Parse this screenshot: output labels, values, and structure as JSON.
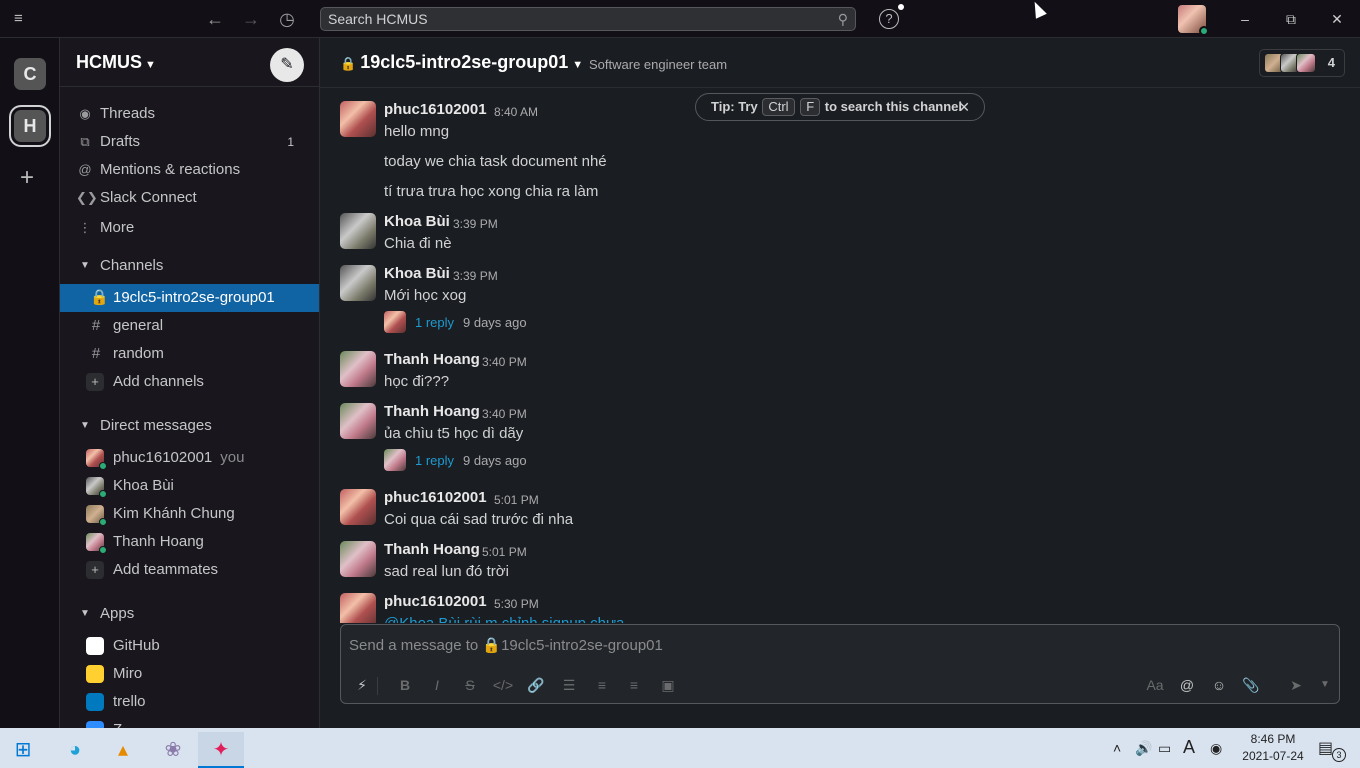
{
  "topbar": {
    "search_placeholder": "Search HCMUS",
    "help_label": "?"
  },
  "workspaces": [
    {
      "letter": "C"
    },
    {
      "letter": "H"
    }
  ],
  "sidebar": {
    "workspace_name": "HCMUS",
    "nav": [
      {
        "label": "Threads",
        "icon": "threads-icon"
      },
      {
        "label": "Drafts",
        "icon": "drafts-icon",
        "count": "1"
      },
      {
        "label": "Mentions & reactions",
        "icon": "at-icon"
      },
      {
        "label": "Slack Connect",
        "icon": "slack-connect-icon"
      },
      {
        "label": "More",
        "icon": "more-vertical-icon"
      }
    ],
    "channels_header": "Channels",
    "channels": [
      {
        "name": "19clc5-intro2se-group01",
        "private": true,
        "selected": true
      },
      {
        "name": "general",
        "private": false
      },
      {
        "name": "random",
        "private": false
      }
    ],
    "add_channels": "Add channels",
    "dm_header": "Direct messages",
    "dms": [
      {
        "name": "phuc16102001",
        "you": "you"
      },
      {
        "name": "Khoa Bùi"
      },
      {
        "name": "Kim Khánh Chung"
      },
      {
        "name": "Thanh Hoang"
      }
    ],
    "add_teammates": "Add teammates",
    "apps_header": "Apps",
    "apps": [
      {
        "name": "GitHub",
        "color": "#ffffff"
      },
      {
        "name": "Miro",
        "color": "#ffd02f"
      },
      {
        "name": "trello",
        "color": "#0079bf"
      },
      {
        "name": "Z",
        "color": "#2d8cff"
      }
    ]
  },
  "channel": {
    "name": "19clc5-intro2se-group01",
    "topic": "Software engineer team",
    "member_count": "4"
  },
  "tip": {
    "prefix": "Tip: Try",
    "key1": "Ctrl",
    "key2": "F",
    "suffix": "to search this channel"
  },
  "messages": [
    {
      "author": "phuc16102001",
      "time": "8:40 AM",
      "lines": [
        "hello mng",
        "today we chia task document nhé",
        "tí trưa trưa học xong chia ra làm"
      ]
    },
    {
      "author": "Khoa Bùi",
      "time": "3:39 PM",
      "lines": [
        "Chia đi nè"
      ]
    },
    {
      "author": "Khoa Bùi",
      "time": "3:39 PM",
      "lines": [
        "Mới học xog"
      ],
      "reply": {
        "count": "1 reply",
        "ago": "9 days ago"
      }
    },
    {
      "author": "Thanh Hoang",
      "time": "3:40 PM",
      "lines": [
        "học đi???"
      ]
    },
    {
      "author": "Thanh Hoang",
      "time": "3:40 PM",
      "lines": [
        "ủa chìu t5 học dì dãy"
      ],
      "reply": {
        "count": "1 reply",
        "ago": "9 days ago"
      }
    },
    {
      "author": "phuc16102001",
      "time": "5:01 PM",
      "lines": [
        "Coi qua cái sad trước đi nha"
      ]
    },
    {
      "author": "Thanh Hoang",
      "time": "5:01 PM",
      "lines": [
        "sad real lun đó trời"
      ]
    },
    {
      "author": "phuc16102001",
      "time": "5:30 PM",
      "lines": [
        "@Khoa Bùi rùi m chỉnh signup chưa"
      ]
    }
  ],
  "composer": {
    "placeholder": "Send a message to 🔒19clc5-intro2se-group01"
  },
  "taskbar": {
    "time": "8:46 PM",
    "date": "2021-07-24",
    "notifications": "3"
  }
}
